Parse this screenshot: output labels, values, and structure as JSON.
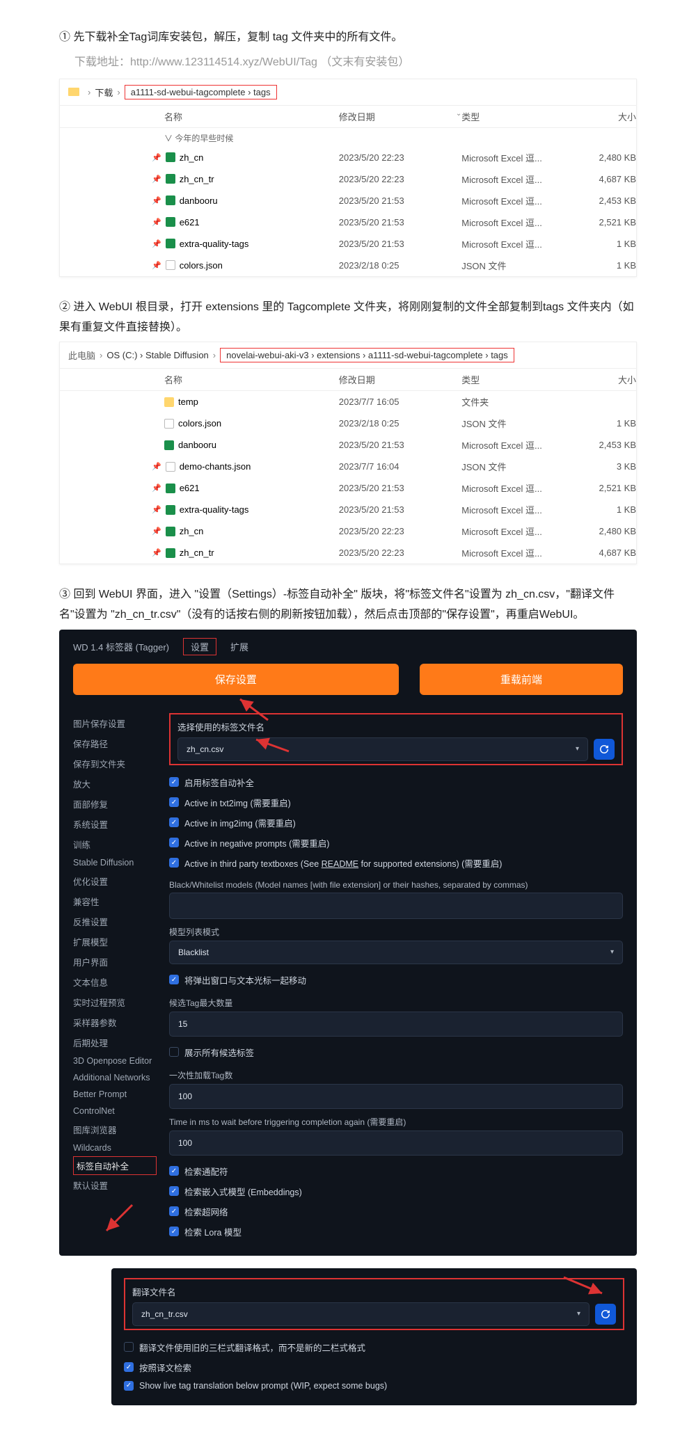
{
  "step1": {
    "title": "① 先下载补全Tag词库安装包，解压，复制 tag 文件夹中的所有文件。",
    "sub": "下载地址：http://www.123114514.xyz/WebUI/Tag （文末有安装包）"
  },
  "explorer1": {
    "crumb_left": "下载",
    "crumb_boxed": "a1111-sd-webui-tagcomplete › tags",
    "headers": {
      "name": "名称",
      "date": "修改日期",
      "type": "类型",
      "size": "大小"
    },
    "group": "∨ 今年的早些时候",
    "files": [
      {
        "name": "zh_cn",
        "date": "2023/5/20 22:23",
        "type": "Microsoft Excel 逗...",
        "size": "2,480 KB",
        "ico": "ico-xls",
        "pin": true
      },
      {
        "name": "zh_cn_tr",
        "date": "2023/5/20 22:23",
        "type": "Microsoft Excel 逗...",
        "size": "4,687 KB",
        "ico": "ico-xls",
        "pin": true
      },
      {
        "name": "danbooru",
        "date": "2023/5/20 21:53",
        "type": "Microsoft Excel 逗...",
        "size": "2,453 KB",
        "ico": "ico-xls",
        "pin": true
      },
      {
        "name": "e621",
        "date": "2023/5/20 21:53",
        "type": "Microsoft Excel 逗...",
        "size": "2,521 KB",
        "ico": "ico-xls",
        "pin": true
      },
      {
        "name": "extra-quality-tags",
        "date": "2023/5/20 21:53",
        "type": "Microsoft Excel 逗...",
        "size": "1 KB",
        "ico": "ico-xls",
        "pin": true
      },
      {
        "name": "colors.json",
        "date": "2023/2/18 0:25",
        "type": "JSON 文件",
        "size": "1 KB",
        "ico": "ico-json",
        "pin": true
      }
    ]
  },
  "step2": {
    "title": "② 进入 WebUI 根目录，打开 extensions 里的 Tagcomplete 文件夹，将刚刚复制的文件全部复制到tags 文件夹内（如果有重复文件直接替换）。"
  },
  "explorer2": {
    "crumb_left": "此电脑",
    "crumb_mid": "OS (C:) › Stable Diffusion",
    "crumb_boxed": "novelai-webui-aki-v3 › extensions › a1111-sd-webui-tagcomplete › tags",
    "headers": {
      "name": "名称",
      "date": "修改日期",
      "type": "类型",
      "size": "大小"
    },
    "files": [
      {
        "name": "temp",
        "date": "2023/7/7 16:05",
        "type": "文件夹",
        "size": "",
        "ico": "ico-folder"
      },
      {
        "name": "colors.json",
        "date": "2023/2/18 0:25",
        "type": "JSON 文件",
        "size": "1 KB",
        "ico": "ico-json"
      },
      {
        "name": "danbooru",
        "date": "2023/5/20 21:53",
        "type": "Microsoft Excel 逗...",
        "size": "2,453 KB",
        "ico": "ico-xls"
      },
      {
        "name": "demo-chants.json",
        "date": "2023/7/7 16:04",
        "type": "JSON 文件",
        "size": "3 KB",
        "ico": "ico-json",
        "pin": true
      },
      {
        "name": "e621",
        "date": "2023/5/20 21:53",
        "type": "Microsoft Excel 逗...",
        "size": "2,521 KB",
        "ico": "ico-xls",
        "pin": true
      },
      {
        "name": "extra-quality-tags",
        "date": "2023/5/20 21:53",
        "type": "Microsoft Excel 逗...",
        "size": "1 KB",
        "ico": "ico-xls",
        "pin": true
      },
      {
        "name": "zh_cn",
        "date": "2023/5/20 22:23",
        "type": "Microsoft Excel 逗...",
        "size": "2,480 KB",
        "ico": "ico-xls",
        "pin": true
      },
      {
        "name": "zh_cn_tr",
        "date": "2023/5/20 22:23",
        "type": "Microsoft Excel 逗...",
        "size": "4,687 KB",
        "ico": "ico-xls",
        "pin": true
      }
    ]
  },
  "step3": {
    "title": "③ 回到 WebUI 界面，进入 \"设置（Settings）-标签自动补全\" 版块，将\"标签文件名\"设置为 zh_cn.csv，\"翻译文件名\"设置为 \"zh_cn_tr.csv\"（没有的话按右侧的刷新按钮加载），然后点击顶部的\"保存设置\"，再重启WebUI。"
  },
  "webui": {
    "tabs": {
      "tagger": "WD 1.4 标签器 (Tagger)",
      "settings": "设置",
      "ext": "扩展"
    },
    "btn_save": "保存设置",
    "btn_reload": "重载前端",
    "sidebar": [
      "图片保存设置",
      "保存路径",
      "保存到文件夹",
      "放大",
      "面部修复",
      "系统设置",
      "训练",
      "Stable Diffusion",
      "优化设置",
      "兼容性",
      "反推设置",
      "扩展模型",
      "用户界面",
      "文本信息",
      "实时过程预览",
      "采样器参数",
      "后期处理",
      "3D Openpose Editor",
      "Additional Networks",
      "Better Prompt",
      "ControlNet",
      "图库浏览器",
      "Wildcards",
      "标签自动补全",
      "默认设置"
    ],
    "sidebar_active_idx": 23,
    "tagfile_label": "选择使用的标签文件名",
    "tagfile_value": "zh_cn.csv",
    "checks": [
      {
        "label": "启用标签自动补全",
        "on": true
      },
      {
        "label": "Active in txt2img (需要重启)",
        "on": true
      },
      {
        "label": "Active in img2img (需要重启)",
        "on": true
      },
      {
        "label": "Active in negative prompts (需要重启)",
        "on": true
      }
    ],
    "check_third_pre": "Active in third party textboxes (See ",
    "check_third_link": "README",
    "check_third_post": " for supported extensions) (需要重启)",
    "blacklist_label": "Black/Whitelist models (Model names [with file extension] or their hashes, separated by commas)",
    "modellist_label": "模型列表模式",
    "modellist_value": "Blacklist",
    "move_cursor": "将弹出窗口与文本光标一起移动",
    "maxcand_label": "候选Tag最大数量",
    "maxcand_value": "15",
    "showall": "展示所有候选标签",
    "onceload_label": "一次性加载Tag数",
    "onceload_value": "100",
    "delay_label": "Time in ms to wait before triggering completion again (需要重启)",
    "delay_value": "100",
    "checks2": [
      {
        "label": "检索通配符",
        "on": true
      },
      {
        "label": "检索嵌入式模型 (Embeddings)",
        "on": true
      },
      {
        "label": "检索超网络",
        "on": true
      },
      {
        "label": "检索 Lora 模型",
        "on": true
      }
    ],
    "trans_label": "翻译文件名",
    "trans_value": "zh_cn_tr.csv",
    "trans_note": "翻译文件使用旧的三栏式翻译格式，而不是新的二栏式格式",
    "trans_check": "按照译文检索",
    "trans_show": "Show live tag translation below prompt (WIP, expect some bugs)"
  }
}
